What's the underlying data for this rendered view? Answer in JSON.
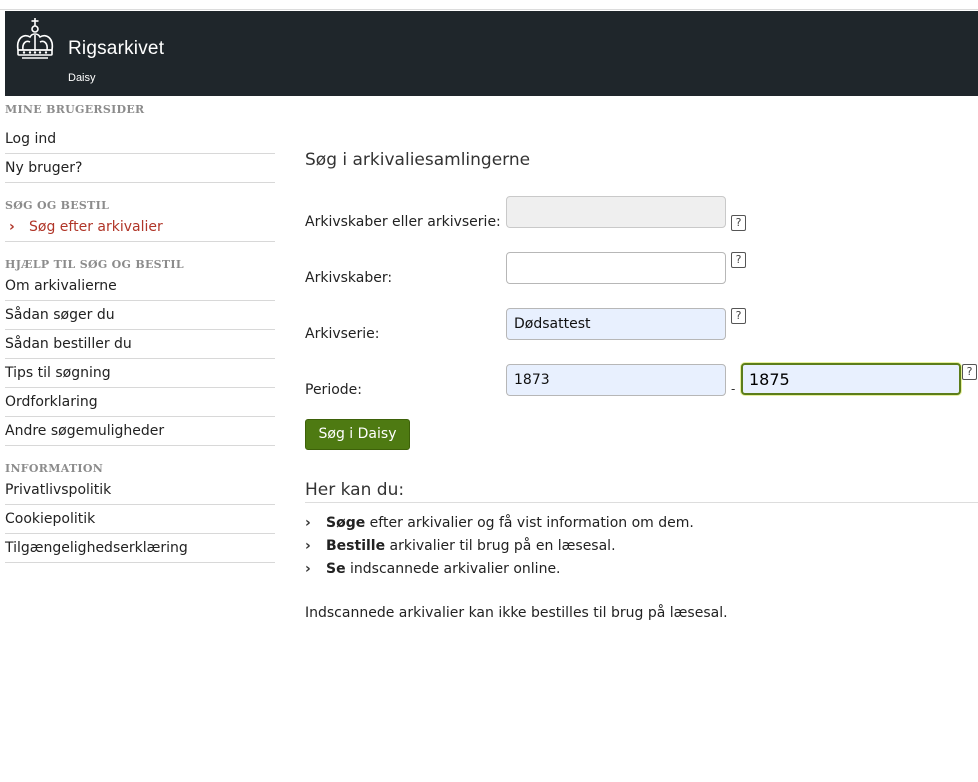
{
  "header": {
    "brand_name": "Rigsarkivet",
    "brand_sub": "Daisy",
    "logo_icon": "royal-crown-icon",
    "colors": {
      "header_bg": "#1f262b",
      "accent_red": "#b03528",
      "button_green": "#4e7a12"
    }
  },
  "sidebar": {
    "sections": [
      {
        "title": "MINE BRUGERSIDER",
        "items": [
          "Log ind",
          "Ny bruger?"
        ]
      },
      {
        "title": "SØG OG BESTIL",
        "items": [
          "Søg efter arkivalier"
        ],
        "active_item": "Søg efter arkivalier"
      },
      {
        "title": "HJÆLP TIL SØG OG BESTIL",
        "items": [
          "Om arkivalierne",
          "Sådan søger du",
          "Sådan bestiller du",
          "Tips til søgning",
          "Ordforklaring",
          "Andre søgemuligheder"
        ]
      },
      {
        "title": "INFORMATION",
        "items": [
          "Privatlivspolitik",
          "Cookiepolitik",
          "Tilgængelighedserklæring"
        ]
      }
    ]
  },
  "main": {
    "title": "Søg i arkivaliesamlingerne",
    "form": {
      "arkivskaber_eller_serie_label": "Arkivskaber eller arkivserie:",
      "arkivskaber_eller_serie_value": "",
      "arkivskaber_label": "Arkivskaber:",
      "arkivskaber_value": "",
      "arkivserie_label": "Arkivserie:",
      "arkivserie_value": "Dødsattest",
      "periode_label": "Periode:",
      "periode_from": "1873",
      "periode_separator": "-",
      "periode_to": "1875",
      "help_glyph": "?",
      "submit_label": "Søg i Daisy"
    },
    "info_title": "Her kan du:",
    "bullets": [
      {
        "bold": "Søge",
        "rest": " efter arkivalier og få vist information om dem."
      },
      {
        "bold": "Bestille",
        "rest": " arkivalier til brug på en læsesal."
      },
      {
        "bold": "Se",
        "rest": " indscannede arkivalier online."
      }
    ],
    "note": "Indscannede arkivalier kan ikke bestilles til brug på læsesal."
  }
}
